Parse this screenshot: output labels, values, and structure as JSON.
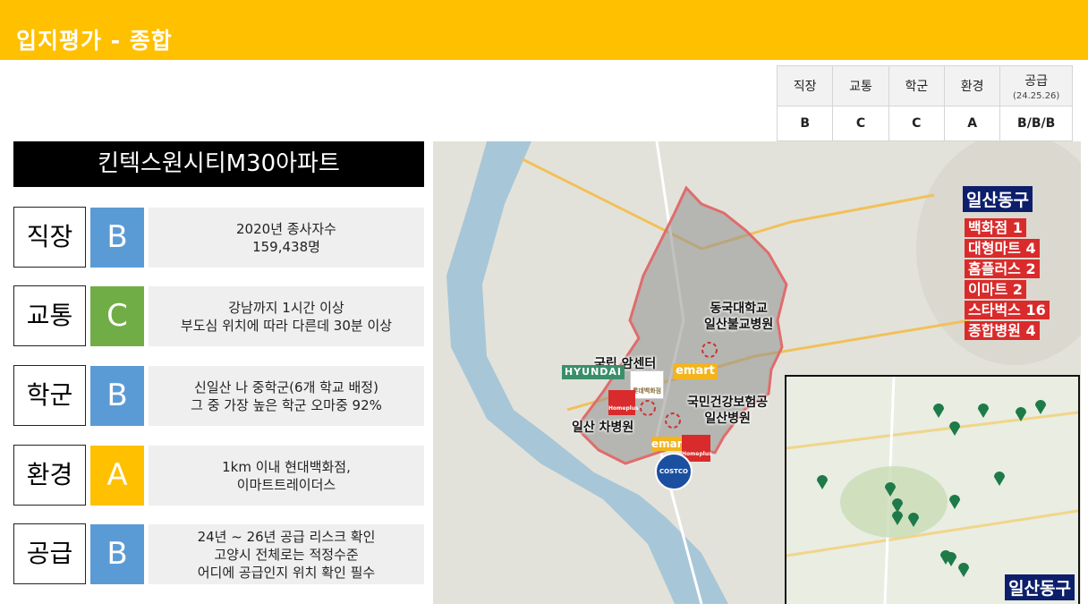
{
  "header": {
    "title": "입지평가 - 종합"
  },
  "grade_table": {
    "headers": [
      {
        "label": "직장",
        "sub": ""
      },
      {
        "label": "교통",
        "sub": ""
      },
      {
        "label": "학군",
        "sub": ""
      },
      {
        "label": "환경",
        "sub": ""
      },
      {
        "label": "공급",
        "sub": "(24.25.26)"
      }
    ],
    "values": [
      "B",
      "C",
      "C",
      "A",
      "B/B/B"
    ]
  },
  "property": {
    "name": "킨텍스원시티M30아파트"
  },
  "criteria": [
    {
      "label": "직장",
      "grade": "B",
      "color": "#5B9BD5",
      "lines": [
        "2020년 종사자수",
        "159,438명"
      ]
    },
    {
      "label": "교통",
      "grade": "C",
      "color": "#70AD47",
      "lines": [
        "강남까지 1시간 이상",
        "부도심 위치에 따라 다른데 30분 이상"
      ]
    },
    {
      "label": "학군",
      "grade": "B",
      "color": "#5B9BD5",
      "lines": [
        "신일산 나 중학군(6개 학교 배정)",
        "그 중 가장 높은 학군 오마중 92%"
      ]
    },
    {
      "label": "환경",
      "grade": "A",
      "color": "#FFC000",
      "lines": [
        "1km 이내 현대백화점,",
        "이마트트레이더스"
      ]
    },
    {
      "label": "공급",
      "grade": "B",
      "color": "#5B9BD5",
      "lines": [
        "24년 ~ 26년 공급 리스크 확인",
        "고양시 전체로는 적정수준",
        "어디에 공급인지 위치 확인 필수"
      ]
    }
  ],
  "map": {
    "district": "일산동구",
    "amenities": [
      "백화점 1",
      "대형마트 4",
      "홈플러스 2",
      "이마트 2",
      "스타벅스 16",
      "종합병원 4"
    ],
    "labels": {
      "dongguk": [
        "동국대학교",
        "일산불교병원"
      ],
      "center": "국립 암센터",
      "nhis": [
        "국민건강보험공",
        "일산병원"
      ],
      "cha": "일산 차병원"
    },
    "logos": {
      "hyundai": "HYUNDAI",
      "emart": "emart",
      "lotte": "롯데백화점",
      "homeplus": "Homeplus",
      "costco": "COSTCO"
    },
    "inset_title": "일산동구"
  }
}
